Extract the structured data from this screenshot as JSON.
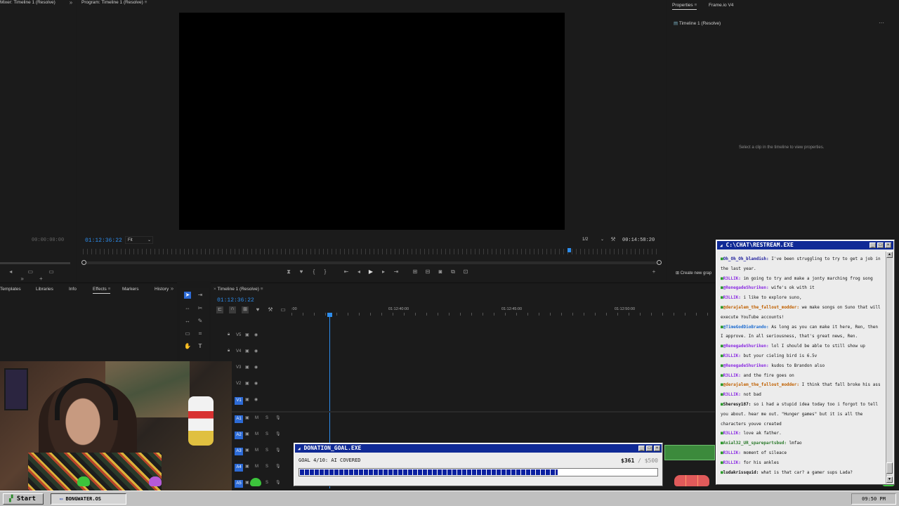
{
  "source_monitor": {
    "tab": "Mixer: Timeline 1 (Resolve)",
    "timecode": "00:00:00:00"
  },
  "program_monitor": {
    "tab": "Program: Timeline 1 (Resolve)",
    "timecode": "01:12:36:22",
    "fit": "Fit",
    "resolution": "1/2",
    "duration": "00:14:58:20",
    "playhead_fraction": 0.84
  },
  "properties": {
    "tabs": [
      "Properties",
      "Frame.io V4"
    ],
    "item": "Timeline 1 (Resolve)",
    "empty_message": "Select a clip in the timeline to view properties.",
    "create_label": "Create new grap"
  },
  "effects_panel": {
    "tabs": [
      "Templates",
      "Libraries",
      "Info",
      "Effects",
      "Markers",
      "History"
    ]
  },
  "timeline": {
    "tab": "Timeline 1 (Resolve)",
    "timecode": "01:12:36:22",
    "ruler": [
      ":00",
      "01:12:40:00",
      "01:12:45:00",
      "01:12:50:00"
    ],
    "video_tracks": [
      "V5",
      "V4",
      "V3",
      "V2",
      "V1"
    ],
    "audio_tracks": [
      "A1",
      "A2",
      "A3",
      "A4",
      "A5"
    ],
    "audio_marks": [
      "M",
      "S"
    ]
  },
  "chat": {
    "title": "C:\\CHAT\\RESTREAM.EXE",
    "messages": [
      {
        "user": "Oh_Oh_Oh_blandish",
        "color": "#1a1a9a",
        "text": "I've been struggling to try to get a job in"
      },
      {
        "user": "",
        "color": "#111",
        "text": "the last year."
      },
      {
        "user": "R3LLIK",
        "color": "#8a2be2",
        "text": "im going to try and make a jonty marching frog song"
      },
      {
        "user": "@RenegadeShuriken",
        "color": "#8a2be2",
        "text": "wife's ok with it"
      },
      {
        "user": "R3LLIK",
        "color": "#8a2be2",
        "text": "i like to explore suno,"
      },
      {
        "user": "@derajalem_the_fallout_modder",
        "color": "#c06000",
        "text": "we make songs on Suno that will"
      },
      {
        "user": "",
        "color": "#111",
        "text": "execute YouTube accounts!"
      },
      {
        "user": "@TimeGodDioBrando",
        "color": "#1a6ad0",
        "text": "As long as you can make it here, Ren, then"
      },
      {
        "user": "",
        "color": "#111",
        "text": "I approve. In all seriousness, that's great news, Ren."
      },
      {
        "user": "@RenegadeShuriken",
        "color": "#8a2be2",
        "text": "lol I should be able to still show up"
      },
      {
        "user": "R3LLIK",
        "color": "#8a2be2",
        "text": "but your cieling bird is 6.5v"
      },
      {
        "user": "@RenegadeShuriken",
        "color": "#8a2be2",
        "text": "kudos to Brandon also"
      },
      {
        "user": "R3LLIK",
        "color": "#8a2be2",
        "text": "and the fire goes on"
      },
      {
        "user": "@derajalem_the_fallout_modder",
        "color": "#c06000",
        "text": "I think that fall broke his ass"
      },
      {
        "user": "R3LLIK",
        "color": "#8a2be2",
        "text": "not bad"
      },
      {
        "user": "Sheresy187",
        "color": "#111",
        "text": "so i had a stupid idea today too i forgot to tell"
      },
      {
        "user": "",
        "color": "#111",
        "text": "you about. hear me out. \"Hunger games\" but it is all the"
      },
      {
        "user": "",
        "color": "#111",
        "text": "characters youve created"
      },
      {
        "user": "R3LLIK",
        "color": "#8a2be2",
        "text": "love ak father."
      },
      {
        "user": "Axial32_UR_sparepartsbud",
        "color": "#2a7a2a",
        "text": "lmfao"
      },
      {
        "user": "R3LLIK",
        "color": "#8a2be2",
        "text": "moment of sileace"
      },
      {
        "user": "R3LLIK",
        "color": "#8a2be2",
        "text": "for his ankles"
      },
      {
        "user": "ludakrissquid",
        "color": "#111",
        "text": "what is that car? a gamer sups Lada?"
      }
    ]
  },
  "donation": {
    "title": "DONATION_GOAL.EXE",
    "goal_label": "GOAL 4/10: AI COVERED",
    "raised": "$361",
    "target": "/ $500",
    "progress": 0.722
  },
  "taskbar": {
    "start": "Start",
    "app": "BONGWATER.OS",
    "clock": "09:50 PM"
  }
}
